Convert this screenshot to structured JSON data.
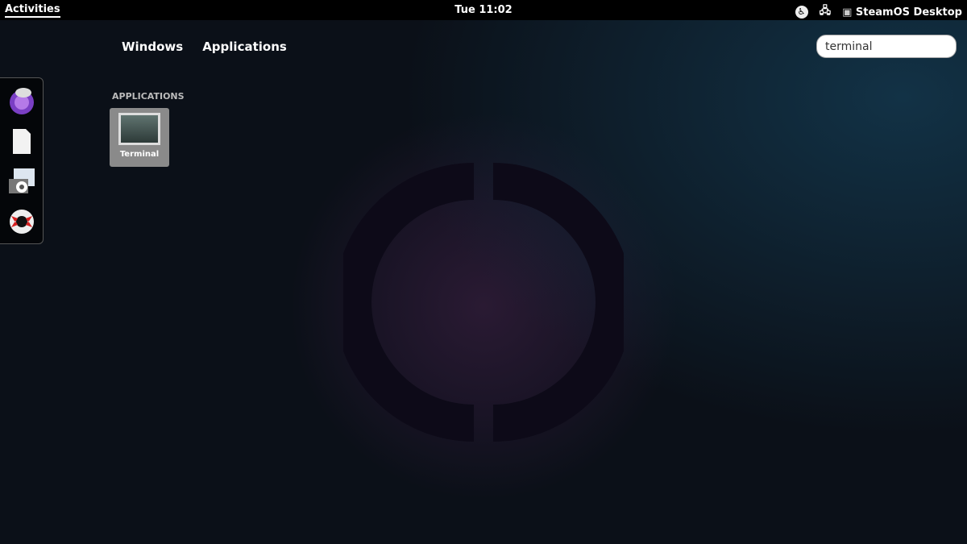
{
  "topbar": {
    "activities": "Activities",
    "clock": "Tue 11:02",
    "user": "SteamOS Desktop"
  },
  "overview": {
    "tabs": [
      "Windows",
      "Applications"
    ],
    "search": {
      "value": "terminal"
    }
  },
  "results": {
    "header": "APPLICATIONS",
    "items": [
      {
        "label": "Terminal"
      }
    ]
  },
  "dash": {
    "items": [
      "web-browser",
      "files",
      "screenshot",
      "help"
    ]
  }
}
